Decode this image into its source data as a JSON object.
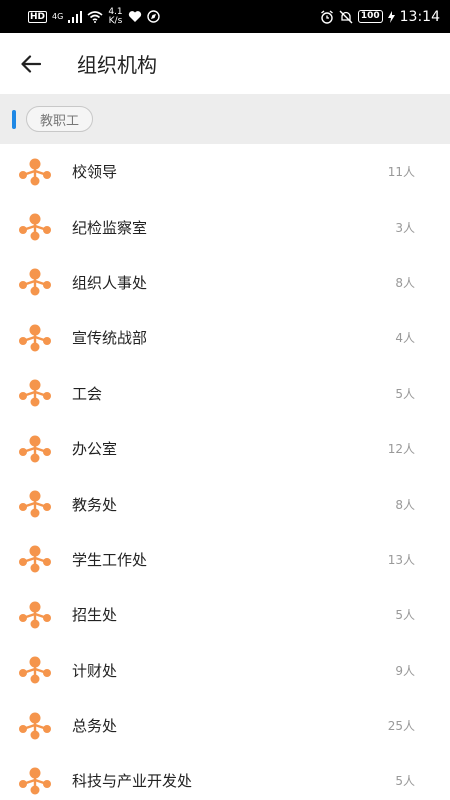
{
  "status_bar": {
    "hd": "HD",
    "network": "4G",
    "speed_value": "4.1",
    "speed_unit": "K/s",
    "battery": "100",
    "time": "13:14"
  },
  "app_bar": {
    "back_icon": "arrow-left-icon",
    "title": "组织机构"
  },
  "breadcrumb": {
    "chip_label": "教职工",
    "accent_color": "#1e88e5"
  },
  "departments": [
    {
      "name": "校领导",
      "count": "11人"
    },
    {
      "name": "纪检监察室",
      "count": "3人"
    },
    {
      "name": "组织人事处",
      "count": "8人"
    },
    {
      "name": "宣传统战部",
      "count": "4人"
    },
    {
      "name": "工会",
      "count": "5人"
    },
    {
      "name": "办公室",
      "count": "12人"
    },
    {
      "name": "教务处",
      "count": "8人"
    },
    {
      "name": "学生工作处",
      "count": "13人"
    },
    {
      "name": "招生处",
      "count": "5人"
    },
    {
      "name": "计财处",
      "count": "9人"
    },
    {
      "name": "总务处",
      "count": "25人"
    },
    {
      "name": "科技与产业开发处",
      "count": "5人"
    }
  ],
  "icon_color": "#f5954c",
  "dept_icon": "org-tree-icon"
}
